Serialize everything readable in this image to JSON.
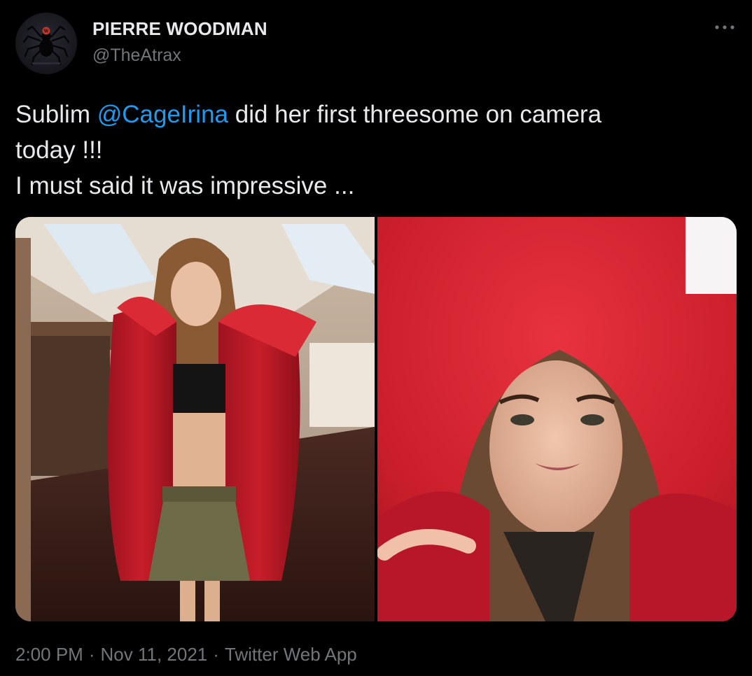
{
  "author": {
    "display_name": "PIERRE WOODMAN",
    "handle": "@TheAtrax",
    "avatar_icon": "spider-logo-icon"
  },
  "more_icon": "more-horizontal-icon",
  "tweet": {
    "text_prefix": "Sublim ",
    "mention": "@CageIrina",
    "text_line1_suffix": " did her first threesome on camera",
    "text_line2": "today !!!",
    "text_line3": "I must said it was impressive ..."
  },
  "media": {
    "photos": [
      {
        "name": "photo-woman-red-parka-full-body"
      },
      {
        "name": "photo-woman-red-fur-hood-closeup"
      }
    ]
  },
  "meta": {
    "time": "2:00 PM",
    "separator": "·",
    "date": "Nov 11, 2021",
    "source": "Twitter Web App"
  },
  "colors": {
    "background": "#000000",
    "text": "#e7e9ea",
    "secondary": "#71767b",
    "link": "#1d9bf0",
    "parka_red": "#c81e2a"
  }
}
